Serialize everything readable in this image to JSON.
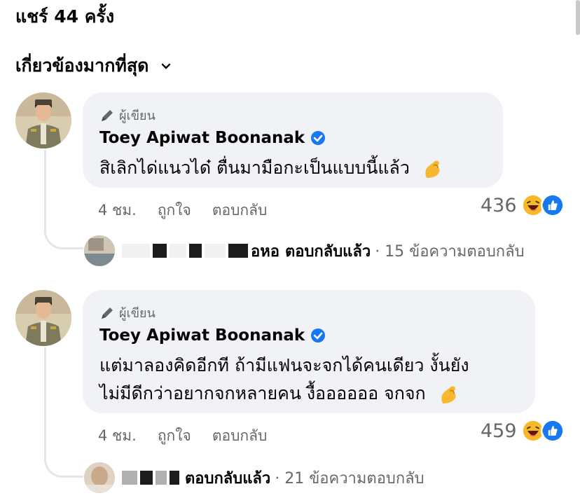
{
  "header": {
    "shares": "แชร์ 44 ครั้ง",
    "sort_label": "เกี่ยวข้องมากที่สุด"
  },
  "comments": [
    {
      "author_tag": "ผู้เขียน",
      "name": "Toey Apiwat Boonanak",
      "lines": [
        "สิเลิกได่แนวได๋ ตื่นมามือกะเป็นแบบนี้แล้ว"
      ],
      "time": "4 ชม.",
      "like": "ถูกใจ",
      "reply": "ตอบกลับ",
      "reaction_count": "436",
      "replies_author_suffix": "อหอ",
      "replies_label": "ตอบกลับแล้ว",
      "replies_meta": "· 15 ข้อความตอบกลับ"
    },
    {
      "author_tag": "ผู้เขียน",
      "name": "Toey Apiwat Boonanak",
      "lines": [
        "แต่มาลองคิดอีกที ถ้ามีแฟนจะจกได้คนเดียว งั้นยัง",
        "ไม่มีดีกว่าอยากจกหลายคน งื้ออออออ จกจก"
      ],
      "time": "4 ชม.",
      "like": "ถูกใจ",
      "reply": "ตอบกลับ",
      "reaction_count": "459",
      "replies_author_suffix": "",
      "replies_label": "ตอบกลับแล้ว",
      "replies_meta": "· 21 ข้อความตอบกลับ"
    }
  ],
  "colors": {
    "accent": "#1877f2",
    "bubble": "#f0f2f5",
    "muted": "#65676b"
  },
  "icons": [
    "chevron-down-icon",
    "pen-icon",
    "verified-badge-icon",
    "pinching-hand-emoji",
    "haha-reaction-icon",
    "like-reaction-icon"
  ]
}
